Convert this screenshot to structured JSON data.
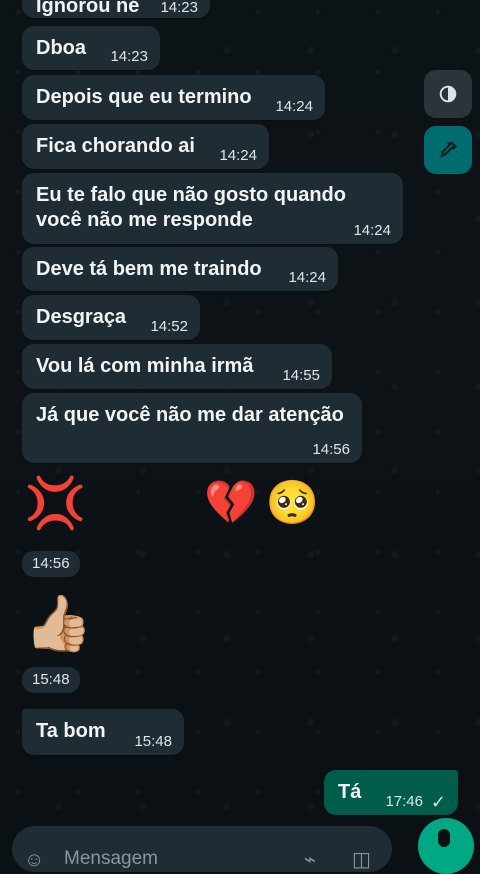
{
  "chat": {
    "messages": [
      {
        "text": "Ignorou né",
        "time": "14:23"
      },
      {
        "text": "Dboa",
        "time": "14:23"
      },
      {
        "text": "Depois que eu termino",
        "time": "14:24"
      },
      {
        "text": "Fica chorando ai",
        "time": "14:24"
      },
      {
        "text": "Eu te falo que não gosto quando\nvocê não me responde",
        "time": "14:24"
      },
      {
        "text": "Deve tá bem me traindo",
        "time": "14:24"
      },
      {
        "text": "Desgraça",
        "time": "14:52"
      },
      {
        "text": "Vou lá com minha irmã",
        "time": "14:55"
      },
      {
        "text": "Já que você não me dar atenção",
        "time": "14:56"
      },
      {
        "emojis": [
          "💢",
          "💔",
          "🥺"
        ],
        "time": "14:56"
      },
      {
        "emojis": [
          "👍🏼"
        ],
        "time": "15:48"
      },
      {
        "text": "Ta bom",
        "time": "15:48"
      },
      {
        "text": "Tá",
        "time": "17:46",
        "status": "✓"
      }
    ]
  },
  "composer": {
    "placeholder": "Mensagem"
  },
  "icons": {
    "contrast": "contrast-icon",
    "eyedropper": "eyedropper-icon",
    "emoji": "emoji-icon",
    "attach": "paperclip-icon",
    "camera": "camera-icon",
    "mic": "microphone-icon"
  },
  "colors": {
    "background": "#0b1014",
    "incoming_bubble": "#202c33",
    "outgoing_bubble": "#005c4b",
    "accent": "#00a884",
    "teal_button": "#007c80"
  }
}
